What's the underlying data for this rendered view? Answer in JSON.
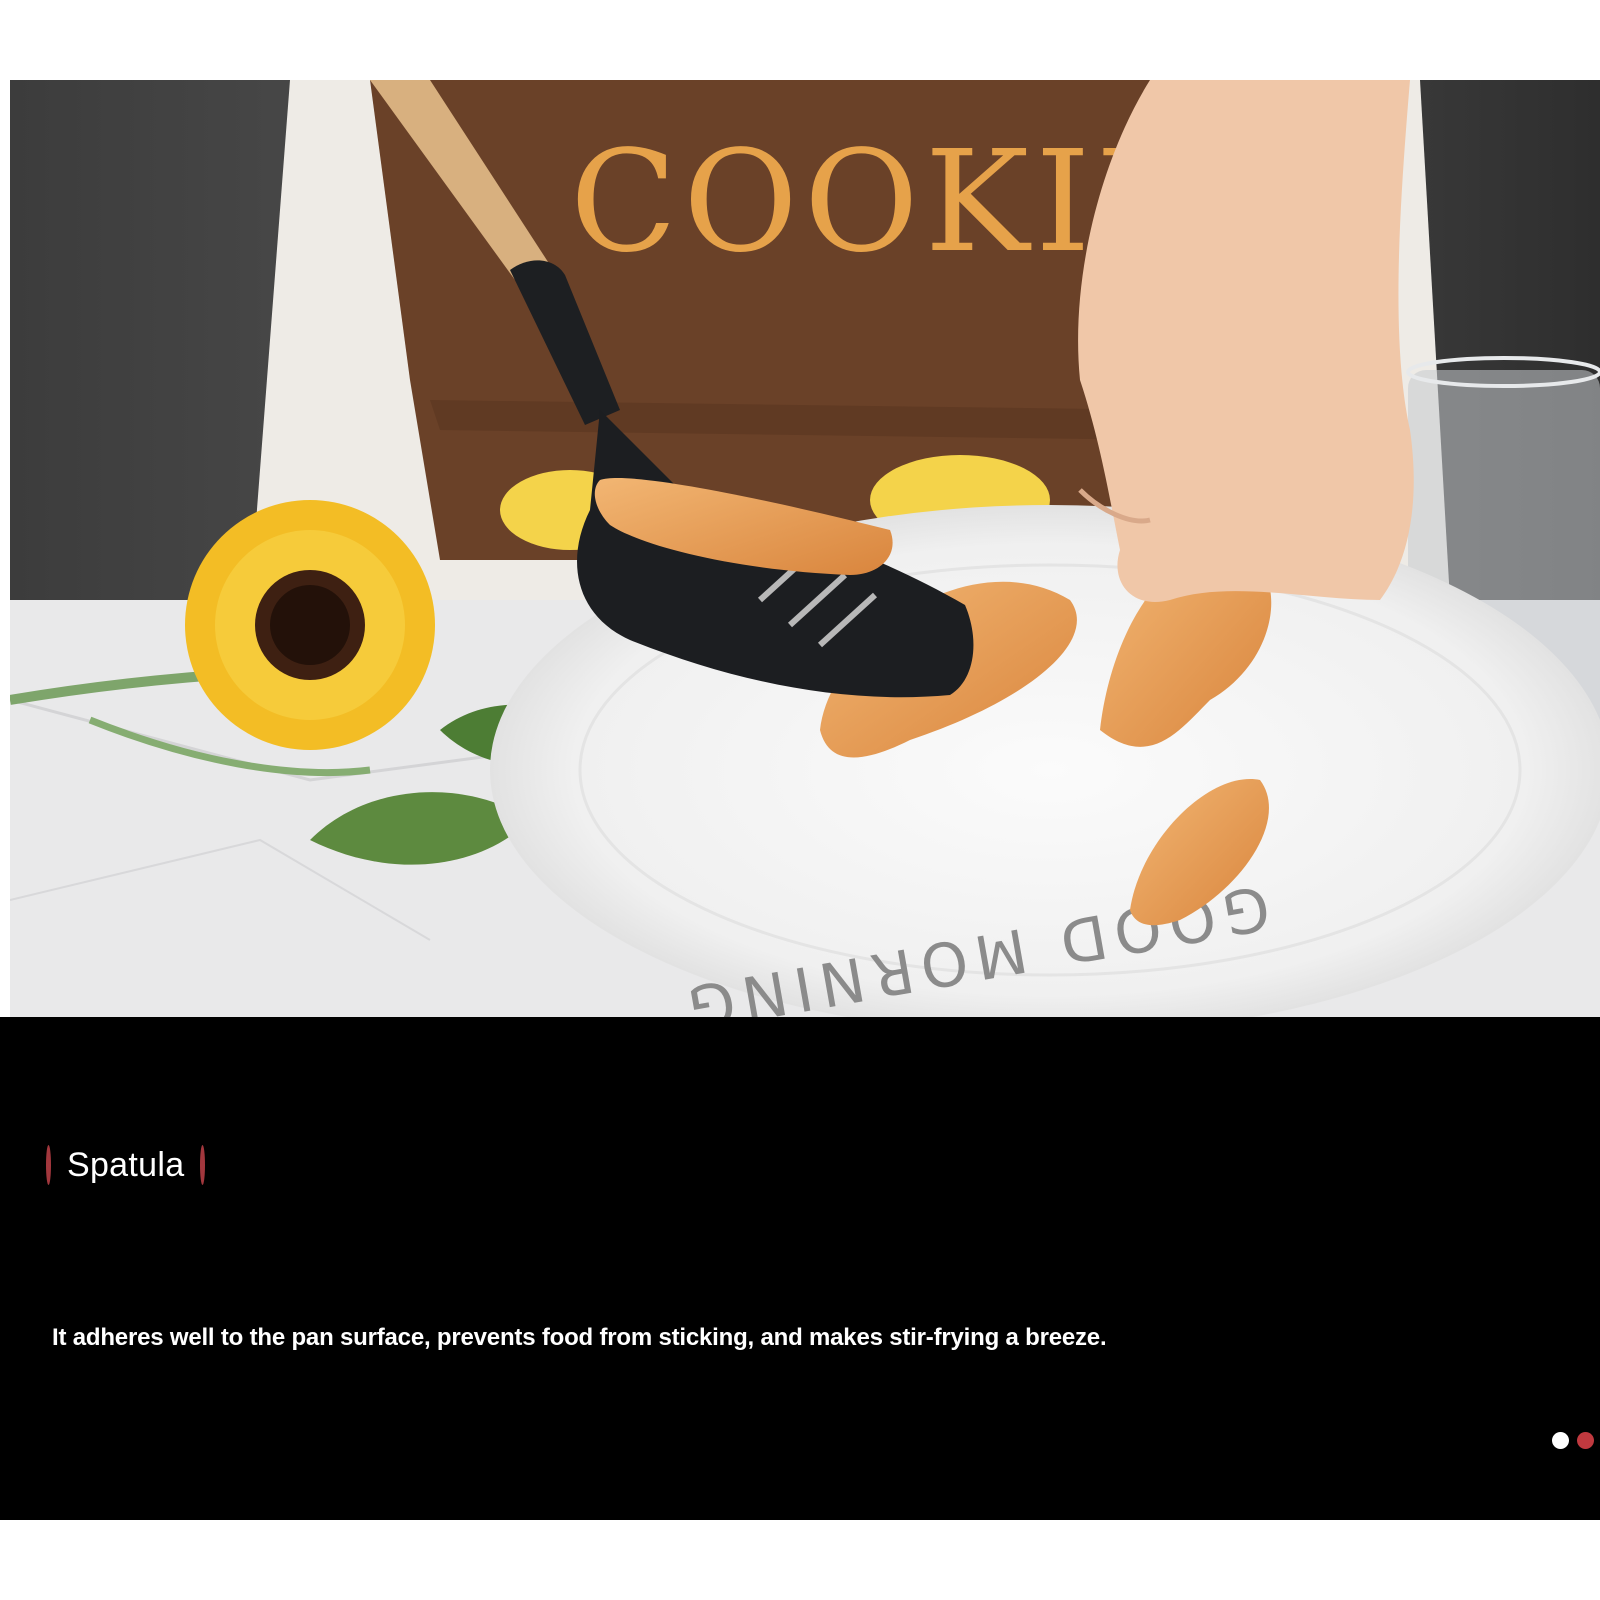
{
  "photo": {
    "apron_text": "COOKING",
    "plate_text": "GOOD MORNING"
  },
  "product": {
    "title": "Spatula",
    "description": "It adheres well to the pan surface, prevents food from sticking, and makes stir-frying a breeze."
  },
  "carousel": {
    "dots": [
      {
        "state": "inactive",
        "color": "#ffffff"
      },
      {
        "state": "active",
        "color": "#c0393f"
      }
    ]
  },
  "colors": {
    "panel_bg": "#000000",
    "accent": "#a2373d",
    "text": "#ffffff"
  }
}
